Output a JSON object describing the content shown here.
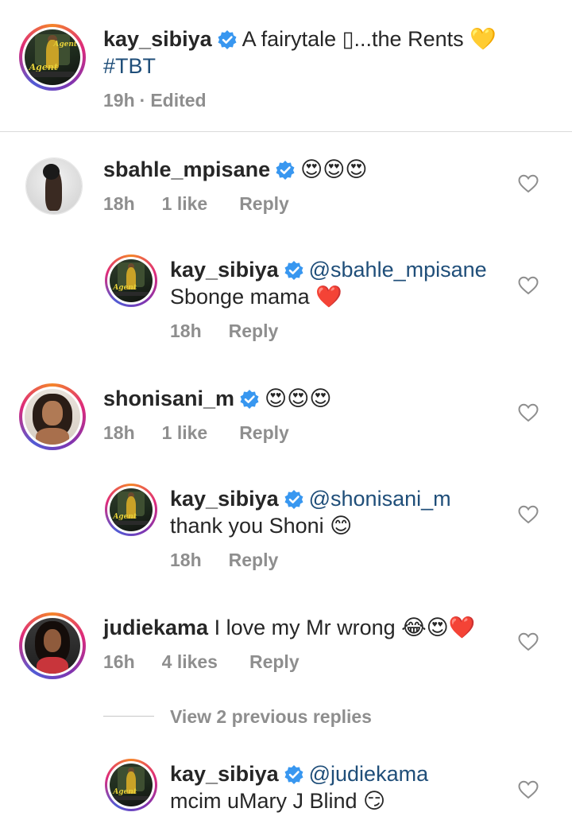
{
  "caption": {
    "username": "kay_sibiya",
    "text": "A fairytale ",
    "glyph": "▯",
    "text2": "...the Rents ",
    "emoji": "💛",
    "hashtag": "#TBT",
    "time": "19h",
    "separator": "·",
    "edited": "Edited"
  },
  "comments": [
    {
      "username": "sbahle_mpisane",
      "text": "",
      "emoji": "😍😍😍",
      "time": "18h",
      "likes": "1 like",
      "reply": "Reply"
    },
    {
      "username": "kay_sibiya",
      "mention": "@sbahle_mpisane",
      "text": "Sbonge mama ",
      "emoji": "❤️",
      "time": "18h",
      "reply": "Reply"
    },
    {
      "username": "shonisani_m",
      "text": "",
      "emoji": "😍😍😍",
      "time": "18h",
      "likes": "1 like",
      "reply": "Reply"
    },
    {
      "username": "kay_sibiya",
      "mention": "@shonisani_m",
      "text": "thank you Shoni ",
      "emoji": "😊",
      "time": "18h",
      "reply": "Reply"
    },
    {
      "username": "judiekama",
      "text": " I love my Mr wrong ",
      "emoji": "😂😍❤️",
      "time": "16h",
      "likes": "4 likes",
      "reply": "Reply"
    },
    {
      "username": "kay_sibiya",
      "mention": "@judiekama",
      "text": "mcim uMary J Blind ",
      "emoji": "😏"
    }
  ],
  "view_replies": "View 2 previous replies",
  "colors": {
    "verified": "#3897f0",
    "mention": "#1f4e79",
    "meta": "#8e8e8e",
    "heart_stroke": "#8e8e8e"
  },
  "icons": {
    "verified": "verified-badge-icon",
    "heart": "heart-outline-icon"
  }
}
